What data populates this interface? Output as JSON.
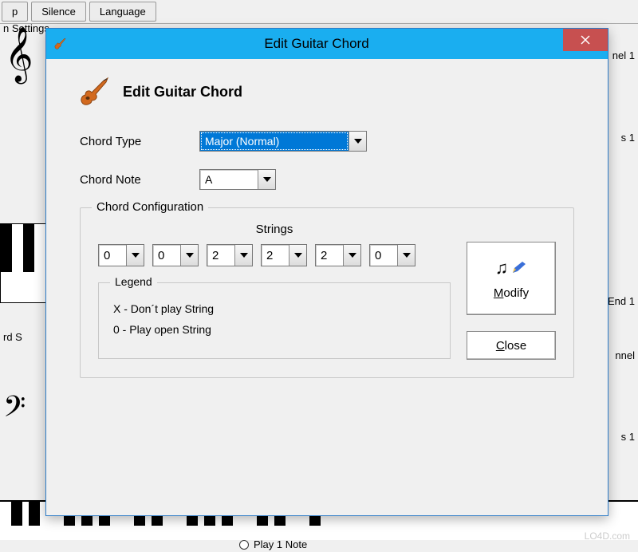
{
  "bg": {
    "settings_text": "n Settings",
    "rd_s": "rd S",
    "silence": "Silence",
    "language": "Language",
    "nel1": "nel 1",
    "s1": "s 1",
    "end1": "End 1",
    "nel": "nnel",
    "s1b": "s 1",
    "play1note": "Play 1 Note",
    "watermark": "LO4D.com"
  },
  "dialog": {
    "title": "Edit Guitar Chord",
    "header": "Edit Guitar Chord",
    "chord_type_label": "Chord Type",
    "chord_type_value": "Major (Normal)",
    "chord_note_label": "Chord Note",
    "chord_note_value": "A",
    "config_legend": "Chord Configuration",
    "strings_label": "Strings",
    "strings": [
      "0",
      "0",
      "2",
      "2",
      "2",
      "0"
    ],
    "legend_title": "Legend",
    "legend_x": "X - Don´t play String",
    "legend_0": "0 - Play open String",
    "modify_label": "Modify",
    "close_label": "Close"
  }
}
